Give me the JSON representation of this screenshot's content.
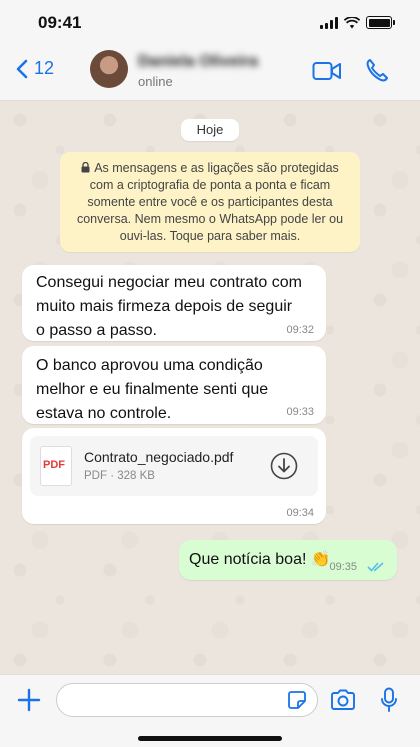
{
  "status_bar": {
    "time": "09:41"
  },
  "header": {
    "back_count": "12",
    "contact_name": "Daniela Oliveira",
    "contact_status": "online",
    "icons": {
      "back": "chevron-left-icon",
      "video": "video-call-icon",
      "phone": "phone-icon"
    }
  },
  "chat": {
    "date_label": "Hoje",
    "encryption_notice": "As mensagens e as ligações são protegidas com a criptografia de ponta a ponta e ficam somente entre você e os participantes desta conversa. Nem mesmo o WhatsApp pode ler ou ouvi-las. Toque para saber mais.",
    "messages": [
      {
        "direction": "in",
        "lines": [
          "Consegui negociar meu contrato com",
          "muito mais firmeza depois de seguir",
          "o passo a passo."
        ],
        "time": "09:32"
      },
      {
        "direction": "in",
        "lines": [
          "O banco aprovou uma condição",
          "melhor e eu finalmente senti que",
          "estava no controle."
        ],
        "time": "09:33"
      },
      {
        "direction": "in",
        "type": "document",
        "file_label": "PDF",
        "file_name": "Contrato_negociado.pdf",
        "file_meta": "PDF · 328 KB",
        "time": "09:34"
      },
      {
        "direction": "out",
        "text": "Que notícia boa! 👏",
        "time": "09:35",
        "status": "read"
      }
    ]
  },
  "composer": {
    "placeholder": ""
  },
  "colors": {
    "accent": "#1a73e8",
    "outgoing_bubble": "#d9fdd3",
    "notice_bg": "#fdf3c7",
    "read_ticks": "#53bdeb"
  }
}
